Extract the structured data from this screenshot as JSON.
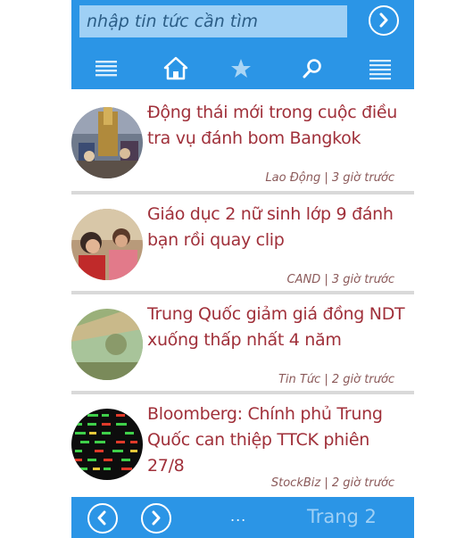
{
  "header": {
    "search_placeholder": "nhập tin tức cần tìm",
    "nav": [
      {
        "icon": "menu-icon"
      },
      {
        "icon": "home-icon"
      },
      {
        "icon": "star-icon"
      },
      {
        "icon": "search-icon"
      },
      {
        "icon": "list-icon"
      }
    ]
  },
  "articles": [
    {
      "title": "Động thái mới trong cuộc điều tra vụ đánh bom Bangkok",
      "source": "Lao Động",
      "time": "3 giờ trước",
      "meta": "Lao Động | 3 giờ trước"
    },
    {
      "title": "Giáo dục 2 nữ sinh lớp 9 đánh bạn rồi quay clip",
      "source": "CAND",
      "time": "3 giờ trước",
      "meta": "CAND | 3 giờ trước"
    },
    {
      "title": "Trung Quốc giảm giá đồng NDT xuống thấp nhất 4 năm",
      "source": "Tin Tức",
      "time": "2 giờ trước",
      "meta": "Tin Tức | 2 giờ trước"
    },
    {
      "title": "Bloomberg: Chính phủ Trung Quốc can thiệp TTCK phiên 27/8",
      "source": "StockBiz",
      "time": "2 giờ trước",
      "meta": "StockBiz | 2 giờ trước"
    }
  ],
  "footer": {
    "more": "...",
    "page_label": "Trang 2"
  },
  "colors": {
    "accent": "#2b95e6",
    "title_text": "#a0303a",
    "search_bg": "#9fd0f5"
  }
}
